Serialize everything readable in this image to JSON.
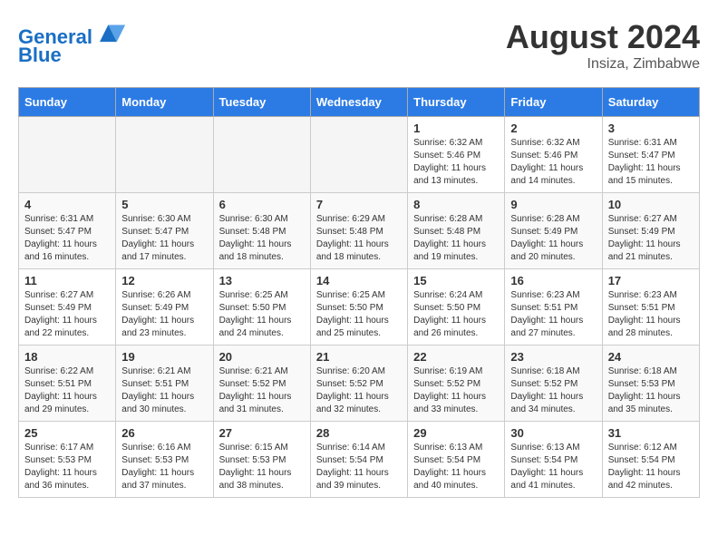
{
  "header": {
    "logo_line1": "General",
    "logo_line2": "Blue",
    "month_year": "August 2024",
    "location": "Insiza, Zimbabwe"
  },
  "days_of_week": [
    "Sunday",
    "Monday",
    "Tuesday",
    "Wednesday",
    "Thursday",
    "Friday",
    "Saturday"
  ],
  "weeks": [
    [
      {
        "day": "",
        "info": ""
      },
      {
        "day": "",
        "info": ""
      },
      {
        "day": "",
        "info": ""
      },
      {
        "day": "",
        "info": ""
      },
      {
        "day": "1",
        "info": "Sunrise: 6:32 AM\nSunset: 5:46 PM\nDaylight: 11 hours and 13 minutes."
      },
      {
        "day": "2",
        "info": "Sunrise: 6:32 AM\nSunset: 5:46 PM\nDaylight: 11 hours and 14 minutes."
      },
      {
        "day": "3",
        "info": "Sunrise: 6:31 AM\nSunset: 5:47 PM\nDaylight: 11 hours and 15 minutes."
      }
    ],
    [
      {
        "day": "4",
        "info": "Sunrise: 6:31 AM\nSunset: 5:47 PM\nDaylight: 11 hours and 16 minutes."
      },
      {
        "day": "5",
        "info": "Sunrise: 6:30 AM\nSunset: 5:47 PM\nDaylight: 11 hours and 17 minutes."
      },
      {
        "day": "6",
        "info": "Sunrise: 6:30 AM\nSunset: 5:48 PM\nDaylight: 11 hours and 18 minutes."
      },
      {
        "day": "7",
        "info": "Sunrise: 6:29 AM\nSunset: 5:48 PM\nDaylight: 11 hours and 18 minutes."
      },
      {
        "day": "8",
        "info": "Sunrise: 6:28 AM\nSunset: 5:48 PM\nDaylight: 11 hours and 19 minutes."
      },
      {
        "day": "9",
        "info": "Sunrise: 6:28 AM\nSunset: 5:49 PM\nDaylight: 11 hours and 20 minutes."
      },
      {
        "day": "10",
        "info": "Sunrise: 6:27 AM\nSunset: 5:49 PM\nDaylight: 11 hours and 21 minutes."
      }
    ],
    [
      {
        "day": "11",
        "info": "Sunrise: 6:27 AM\nSunset: 5:49 PM\nDaylight: 11 hours and 22 minutes."
      },
      {
        "day": "12",
        "info": "Sunrise: 6:26 AM\nSunset: 5:49 PM\nDaylight: 11 hours and 23 minutes."
      },
      {
        "day": "13",
        "info": "Sunrise: 6:25 AM\nSunset: 5:50 PM\nDaylight: 11 hours and 24 minutes."
      },
      {
        "day": "14",
        "info": "Sunrise: 6:25 AM\nSunset: 5:50 PM\nDaylight: 11 hours and 25 minutes."
      },
      {
        "day": "15",
        "info": "Sunrise: 6:24 AM\nSunset: 5:50 PM\nDaylight: 11 hours and 26 minutes."
      },
      {
        "day": "16",
        "info": "Sunrise: 6:23 AM\nSunset: 5:51 PM\nDaylight: 11 hours and 27 minutes."
      },
      {
        "day": "17",
        "info": "Sunrise: 6:23 AM\nSunset: 5:51 PM\nDaylight: 11 hours and 28 minutes."
      }
    ],
    [
      {
        "day": "18",
        "info": "Sunrise: 6:22 AM\nSunset: 5:51 PM\nDaylight: 11 hours and 29 minutes."
      },
      {
        "day": "19",
        "info": "Sunrise: 6:21 AM\nSunset: 5:51 PM\nDaylight: 11 hours and 30 minutes."
      },
      {
        "day": "20",
        "info": "Sunrise: 6:21 AM\nSunset: 5:52 PM\nDaylight: 11 hours and 31 minutes."
      },
      {
        "day": "21",
        "info": "Sunrise: 6:20 AM\nSunset: 5:52 PM\nDaylight: 11 hours and 32 minutes."
      },
      {
        "day": "22",
        "info": "Sunrise: 6:19 AM\nSunset: 5:52 PM\nDaylight: 11 hours and 33 minutes."
      },
      {
        "day": "23",
        "info": "Sunrise: 6:18 AM\nSunset: 5:52 PM\nDaylight: 11 hours and 34 minutes."
      },
      {
        "day": "24",
        "info": "Sunrise: 6:18 AM\nSunset: 5:53 PM\nDaylight: 11 hours and 35 minutes."
      }
    ],
    [
      {
        "day": "25",
        "info": "Sunrise: 6:17 AM\nSunset: 5:53 PM\nDaylight: 11 hours and 36 minutes."
      },
      {
        "day": "26",
        "info": "Sunrise: 6:16 AM\nSunset: 5:53 PM\nDaylight: 11 hours and 37 minutes."
      },
      {
        "day": "27",
        "info": "Sunrise: 6:15 AM\nSunset: 5:53 PM\nDaylight: 11 hours and 38 minutes."
      },
      {
        "day": "28",
        "info": "Sunrise: 6:14 AM\nSunset: 5:54 PM\nDaylight: 11 hours and 39 minutes."
      },
      {
        "day": "29",
        "info": "Sunrise: 6:13 AM\nSunset: 5:54 PM\nDaylight: 11 hours and 40 minutes."
      },
      {
        "day": "30",
        "info": "Sunrise: 6:13 AM\nSunset: 5:54 PM\nDaylight: 11 hours and 41 minutes."
      },
      {
        "day": "31",
        "info": "Sunrise: 6:12 AM\nSunset: 5:54 PM\nDaylight: 11 hours and 42 minutes."
      }
    ]
  ]
}
